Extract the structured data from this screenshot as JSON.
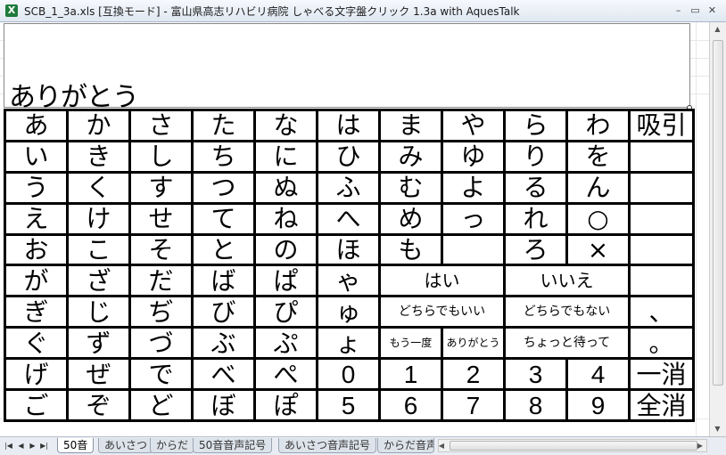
{
  "window": {
    "title": "SCB_1_3a.xls  [互換モード] - 富山県高志リハビリ病院  しゃべる文字盤クリック  1.3a   with AquesTalk",
    "app_icon_letter": "X",
    "minimize": "–",
    "restore": "▭",
    "close": "✕"
  },
  "display": {
    "text": "ありがとう"
  },
  "board": {
    "rows": [
      [
        "あ",
        "か",
        "さ",
        "た",
        "な",
        "は",
        "ま",
        "や",
        "ら",
        "わ",
        "吸引"
      ],
      [
        "い",
        "き",
        "し",
        "ち",
        "に",
        "ひ",
        "み",
        "ゆ",
        "り",
        "を",
        ""
      ],
      [
        "う",
        "く",
        "す",
        "つ",
        "ぬ",
        "ふ",
        "む",
        "よ",
        "る",
        "ん",
        ""
      ],
      [
        "え",
        "け",
        "せ",
        "て",
        "ね",
        "へ",
        "め",
        "っ",
        "れ",
        "○",
        ""
      ],
      [
        "お",
        "こ",
        "そ",
        "と",
        "の",
        "ほ",
        "も",
        "",
        "ろ",
        "×",
        ""
      ],
      [
        "が",
        "ざ",
        "だ",
        "ば",
        "ぱ",
        "ゃ",
        "はい",
        "いいえ",
        ""
      ],
      [
        "ぎ",
        "じ",
        "ぢ",
        "び",
        "ぴ",
        "ゅ",
        "どちらでもいい",
        "どちらでもない",
        "、"
      ],
      [
        "ぐ",
        "ず",
        "づ",
        "ぶ",
        "ぷ",
        "ょ",
        "もう一度",
        "ありがとう",
        "ちょっと待って",
        "。"
      ],
      [
        "げ",
        "ぜ",
        "で",
        "べ",
        "ぺ",
        "0",
        "1",
        "2",
        "3",
        "4",
        "一消"
      ],
      [
        "ご",
        "ぞ",
        "ど",
        "ぼ",
        "ぽ",
        "5",
        "6",
        "7",
        "8",
        "9",
        "全消"
      ]
    ]
  },
  "scrollbar": {
    "up": "▲",
    "down": "▼",
    "left": "◀",
    "right": "▶"
  },
  "sheet_nav": {
    "first": "|◀",
    "prev": "◀",
    "next": "▶",
    "last": "▶|"
  },
  "tabs": [
    {
      "label": "50音",
      "active": true
    },
    {
      "label": "あいさつ",
      "active": false
    },
    {
      "label": "からだ",
      "active": false
    },
    {
      "label": "50音音声記号",
      "active": false
    },
    {
      "label": "あいさつ音声記号",
      "active": false
    },
    {
      "label": "からだ音声",
      "active": false
    }
  ]
}
